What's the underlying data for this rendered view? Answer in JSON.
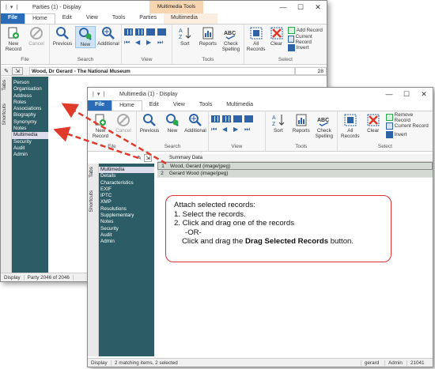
{
  "back_window": {
    "title": "Parties (1) - Display",
    "contextual_group": "Multimedia Tools",
    "tabs": [
      "File",
      "Home",
      "Edit",
      "View",
      "Tools",
      "Parties",
      "Multimedia"
    ],
    "ribbon": {
      "file_group": {
        "label": "File",
        "new": "New Record",
        "cancel": "Cancel"
      },
      "search_group": {
        "label": "Search",
        "previous": "Previous",
        "new": "New",
        "additional": "Additional"
      },
      "view_group": {
        "label": "View"
      },
      "tools_group": {
        "label": "Tools",
        "sort": "Sort",
        "reports": "Reports",
        "check": "Check Spelling"
      },
      "select_group": {
        "label": "Select",
        "all": "All Records",
        "clear": "Clear",
        "add": "Add Record",
        "current": "Current Record",
        "invert": "Invert"
      }
    },
    "record_header": "Wood, Dr Gerard - The National Museum",
    "record_number": "28",
    "vtabs": [
      "Tabs",
      "Shortcuts"
    ],
    "nav": [
      "Person",
      "Organisation",
      "Address",
      "Roles",
      "Associations",
      "Biography",
      "Synonymy",
      "Notes",
      "Multimedia",
      "Security",
      "Audit",
      "Admin"
    ],
    "nav_selected": "Multimedia",
    "status": {
      "mode": "Display",
      "position": "Party 2046 of 2046"
    }
  },
  "front_window": {
    "title": "Multimedia (1) - Display",
    "tabs": [
      "File",
      "Home",
      "Edit",
      "View",
      "Tools",
      "Multimedia"
    ],
    "ribbon": {
      "file_group": {
        "label": "File",
        "new": "New Record",
        "cancel": "Cancel"
      },
      "search_group": {
        "label": "Search",
        "previous": "Previous",
        "new": "New",
        "additional": "Additional"
      },
      "view_group": {
        "label": "View"
      },
      "tools_group": {
        "label": "Tools",
        "sort": "Sort",
        "reports": "Reports",
        "check": "Check Spelling"
      },
      "select_group": {
        "label": "Select",
        "all": "All Records",
        "clear": "Clear",
        "remove": "Remove Record",
        "current": "Current Record",
        "invert": "Invert"
      }
    },
    "vtabs": [
      "Tabs",
      "Shortcuts"
    ],
    "nav": [
      "Multimedia",
      "Details",
      "Characteristics",
      "EXIF",
      "IPTC",
      "XMP",
      "Resolutions",
      "Supplementary",
      "Notes",
      "Security",
      "Audit",
      "Admin"
    ],
    "summary_header": "Summary Data",
    "rows": [
      {
        "num": "1",
        "text": "Wood, Gerard (image/jpeg)"
      },
      {
        "num": "2",
        "text": "Gerard Wood (image/jpeg)"
      }
    ],
    "status": {
      "mode": "Display",
      "matching": "2 matching items, 2 selected",
      "user": "gerard",
      "role": "Admin",
      "num": "21041"
    }
  },
  "callout": {
    "line1": "Attach selected records:",
    "line2": "1. Select the records.",
    "line3": "2. Click and drag one of the records",
    "line4": "-OR-",
    "line5_prefix": "Click and drag the ",
    "line5_bold": "Drag Selected Records",
    "line5_suffix": " button."
  },
  "colors": {
    "accent": "#2b6cb8",
    "nav_bg": "#2c5c66",
    "arrow": "#e03a2a",
    "contextual": "#f6d5b0"
  },
  "icons": {
    "new": "new-record-icon",
    "cancel": "cancel-icon",
    "previous": "search-icon",
    "search_new": "search-new-icon",
    "additional": "additional-search-icon",
    "sort": "sort-icon",
    "reports": "reports-icon",
    "check": "spellcheck-icon",
    "all": "select-all-icon",
    "clear": "clear-icon"
  }
}
